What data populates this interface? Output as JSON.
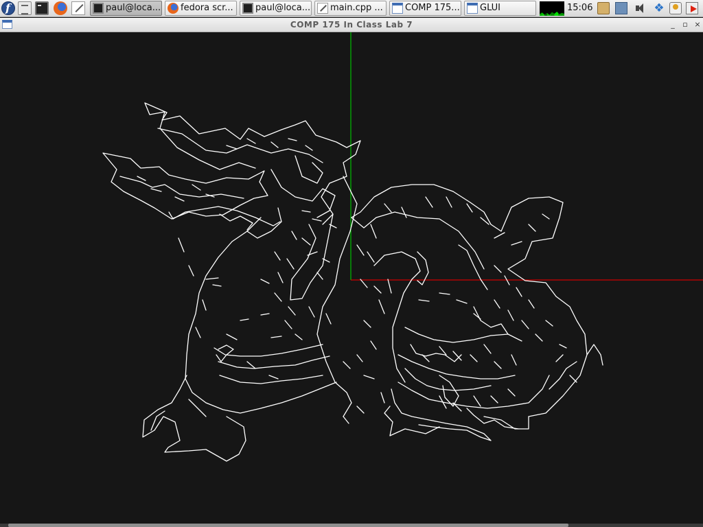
{
  "panel": {
    "launchers": [
      {
        "name": "fedora-menu",
        "icon": "fedora-logo-icon",
        "glyph": "f"
      },
      {
        "name": "files",
        "icon": "file-manager-icon"
      },
      {
        "name": "terminal",
        "icon": "terminal-icon"
      },
      {
        "name": "firefox",
        "icon": "firefox-icon"
      },
      {
        "name": "text-editor",
        "icon": "text-editor-icon"
      }
    ],
    "tasks": [
      {
        "label": "paul@loca...",
        "icon": "terminal-icon",
        "active": true
      },
      {
        "label": "fedora scr...",
        "icon": "firefox-icon",
        "active": false
      },
      {
        "label": "paul@loca...",
        "icon": "terminal-icon",
        "active": false
      },
      {
        "label": "main.cpp ...",
        "icon": "text-editor-icon",
        "active": false
      },
      {
        "label": "COMP 175...",
        "icon": "window-icon",
        "active": false
      },
      {
        "label": "GLUI",
        "icon": "window-icon",
        "active": false
      }
    ],
    "clock": "15:06",
    "tray": [
      "cpu-monitor-icon",
      "clipboard-icon",
      "network-icon",
      "volume-icon",
      "dropbox-icon",
      "update-icon",
      "logout-icon"
    ]
  },
  "window": {
    "title": "COMP 175 In Class Lab 7",
    "controls": {
      "minimize": "_",
      "maximize": "▫",
      "close": "×"
    }
  },
  "scene": {
    "background": "#161616",
    "line_color": "#ffffff",
    "axes": {
      "y_axis_color": "#00c000",
      "x_axis_color": "#d00000"
    },
    "model": "dragon wireframe"
  }
}
